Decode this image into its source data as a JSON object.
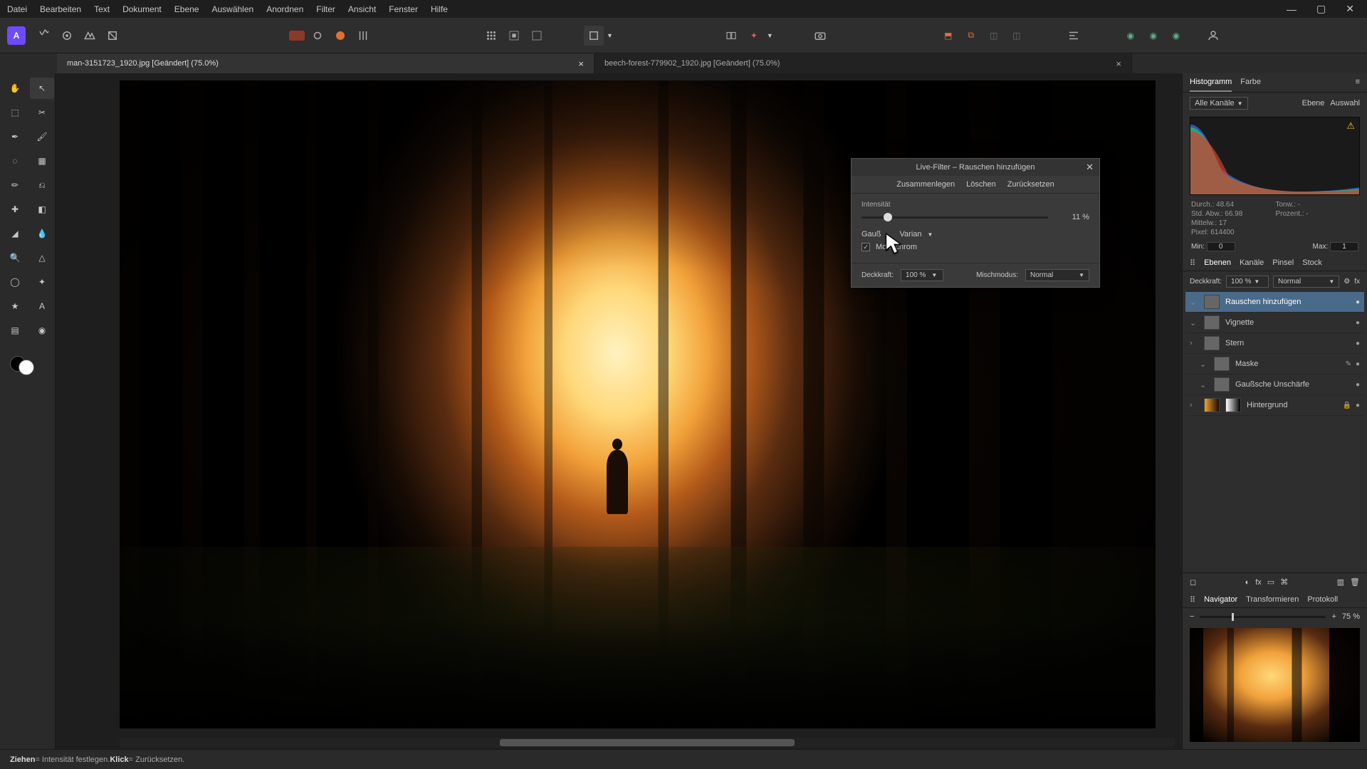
{
  "menu": [
    "Datei",
    "Bearbeiten",
    "Text",
    "Dokument",
    "Ebene",
    "Auswählen",
    "Anordnen",
    "Filter",
    "Ansicht",
    "Fenster",
    "Hilfe"
  ],
  "tabs": [
    {
      "label": "man-3151723_1920.jpg [Geändert] (75.0%)",
      "active": true
    },
    {
      "label": "beech-forest-779902_1920.jpg [Geändert] (75.0%)",
      "active": false
    }
  ],
  "dialog": {
    "title": "Live-Filter – Rauschen hinzufügen",
    "actions": [
      "Zusammenlegen",
      "Löschen",
      "Zurücksetzen"
    ],
    "intensity_label": "Intensität",
    "intensity_value": "11 %",
    "dist_a": "Gauß",
    "dist_b": "Varian",
    "mono_label": "Monochrom",
    "opacity_label": "Deckkraft:",
    "opacity_value": "100 %",
    "blend_label": "Mischmodus:",
    "blend_value": "Normal"
  },
  "rightPanel": {
    "histTabs": [
      "Histogramm",
      "Farbe"
    ],
    "channels": "Alle Kanäle",
    "scope": [
      "Ebene",
      "Auswahl"
    ],
    "stats": {
      "durch": "Durch.: 48.64",
      "std": "Std. Abw.: 66.98",
      "mittelw": "Mittelw.: 17",
      "pixel": "Pixel: 614400",
      "tonw": "Tonw.: -",
      "proz": "Prozent.: -"
    },
    "min_label": "Min:",
    "min_val": "0",
    "max_label": "Max:",
    "max_val": "1",
    "layerTabs": [
      "Ebenen",
      "Kanäle",
      "Pinsel",
      "Stock"
    ],
    "layerOpacityLabel": "Deckkraft:",
    "layerOpacity": "100 %",
    "layerBlend": "Normal",
    "layers": [
      {
        "name": "Rauschen hinzufügen",
        "selected": true,
        "thumb": "plain"
      },
      {
        "name": "Vignette",
        "thumb": "plain"
      },
      {
        "name": "Stern",
        "thumb": "plain"
      },
      {
        "name": "Maske",
        "thumb": "plain",
        "indent": true,
        "edit": true
      },
      {
        "name": "Gaußsche Unschärfe",
        "thumb": "plain",
        "indent": true
      },
      {
        "name": "Hintergrund",
        "thumb": "imggrad",
        "lock": true
      }
    ],
    "navTabs": [
      "Navigator",
      "Transformieren",
      "Protokoll"
    ],
    "zoom": "75 %"
  },
  "status": {
    "drag": "Ziehen",
    "drag_desc": " = Intensität festlegen. ",
    "click": "Klick",
    "click_desc": " = Zurücksetzen."
  }
}
